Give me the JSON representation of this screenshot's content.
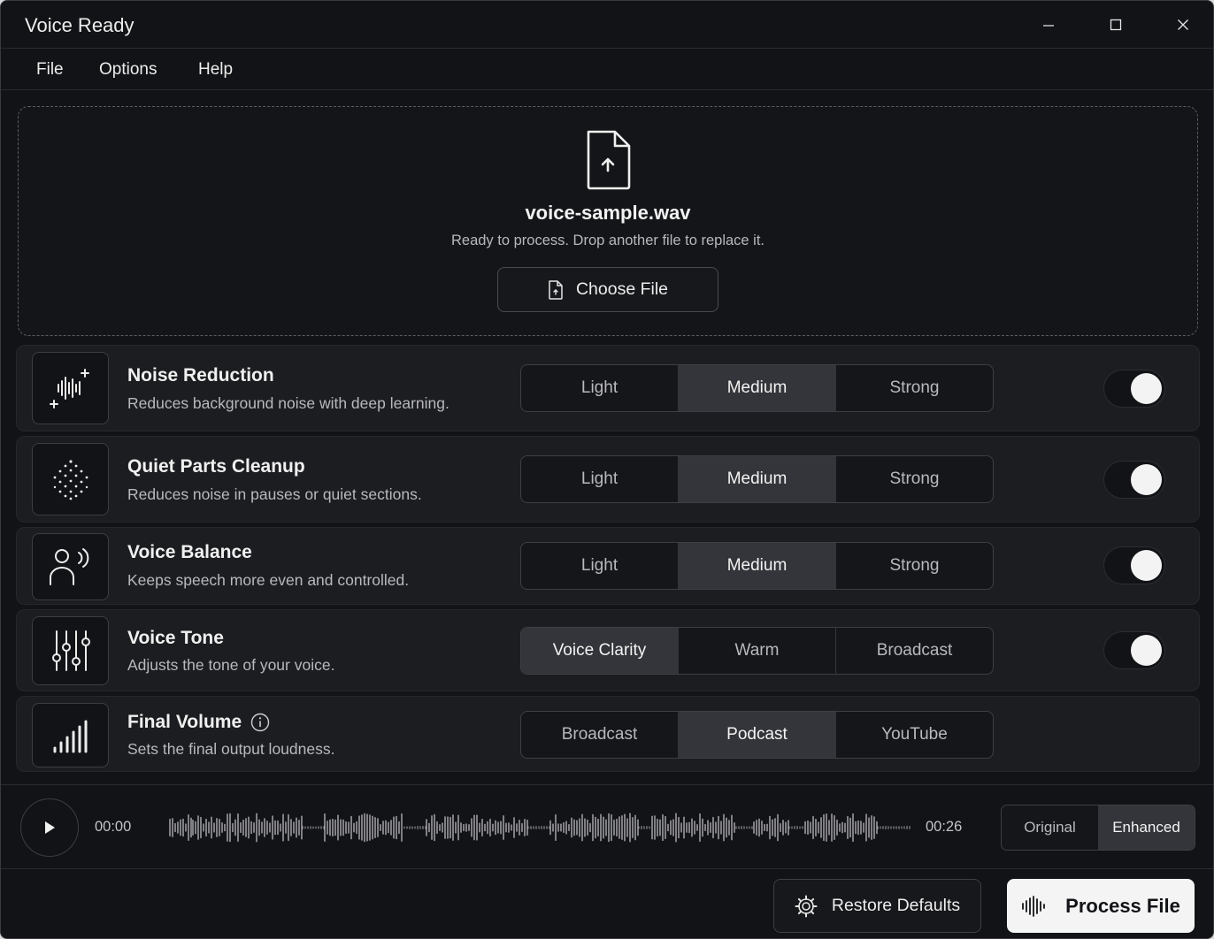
{
  "window": {
    "title": "Voice Ready",
    "controls": [
      "minimize-icon",
      "maximize-icon",
      "close-icon"
    ]
  },
  "menu": [
    "File",
    "Options",
    "Help"
  ],
  "dropzone": {
    "icon": "file-upload-icon",
    "file_name": "voice-sample.wav",
    "status": "Ready to process. Drop another file to replace it.",
    "choose_label": "Choose File"
  },
  "settings": [
    {
      "icon": "noise-reduction-icon",
      "title": "Noise Reduction",
      "description": "Reduces background noise with deep learning.",
      "options": [
        "Light",
        "Medium",
        "Strong"
      ],
      "selected": "Medium",
      "enabled": true
    },
    {
      "icon": "quiet-parts-icon",
      "title": "Quiet Parts Cleanup",
      "description": "Reduces noise in pauses or quiet sections.",
      "options": [
        "Light",
        "Medium",
        "Strong"
      ],
      "selected": "Medium",
      "enabled": true
    },
    {
      "icon": "voice-balance-icon",
      "title": "Voice Balance",
      "description": "Keeps speech more even and controlled.",
      "options": [
        "Light",
        "Medium",
        "Strong"
      ],
      "selected": "Medium",
      "enabled": true
    },
    {
      "icon": "sliders-icon",
      "title": "Voice Tone",
      "description": "Adjusts the tone of your voice.",
      "options": [
        "Voice Clarity",
        "Warm",
        "Broadcast"
      ],
      "selected": "Voice Clarity",
      "enabled": true
    },
    {
      "icon": "volume-bars-icon",
      "title": "Final Volume",
      "description": "Sets the final output loudness.",
      "options": [
        "Broadcast",
        "Podcast",
        "YouTube"
      ],
      "selected": "Podcast",
      "info_icon": "info-icon"
    }
  ],
  "player": {
    "current_time": "00:00",
    "duration": "00:26",
    "compare_options": [
      "Original",
      "Enhanced"
    ],
    "compare_selected": "Enhanced"
  },
  "footer": {
    "restore_label": "Restore Defaults",
    "process_label": "Process File"
  },
  "colors": {
    "background": "#121316",
    "card": "#1c1d20",
    "segment_active": "#34353a",
    "primary_button": "#f4f4f4"
  }
}
